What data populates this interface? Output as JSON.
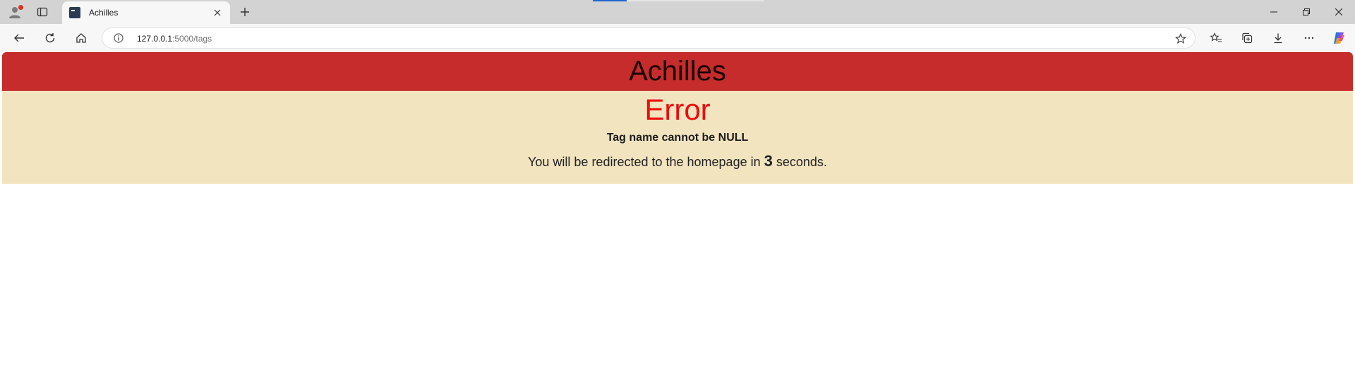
{
  "browser": {
    "tab": {
      "title": "Achilles"
    },
    "address": {
      "host": "127.0.0.1",
      "path": ":5000/tags"
    },
    "icons": [
      "profile-icon",
      "tab-actions-icon",
      "close-icon",
      "plus-icon",
      "back-icon",
      "refresh-icon",
      "home-icon",
      "info-icon",
      "star-icon",
      "favorites-icon",
      "collections-icon",
      "download-icon",
      "more-icon",
      "copilot-icon",
      "minimize-icon",
      "restore-icon",
      "window-close-icon"
    ]
  },
  "app": {
    "title": "Achilles",
    "header_color": "#c62c2c",
    "panel_color": "#f3e4c0"
  },
  "error": {
    "title": "Error",
    "title_color": "#ee0b0b",
    "message": "Tag name cannot be NULL",
    "redirect_prefix": "You will be redirected to the homepage in",
    "countdown": "3",
    "redirect_suffix": "seconds."
  }
}
